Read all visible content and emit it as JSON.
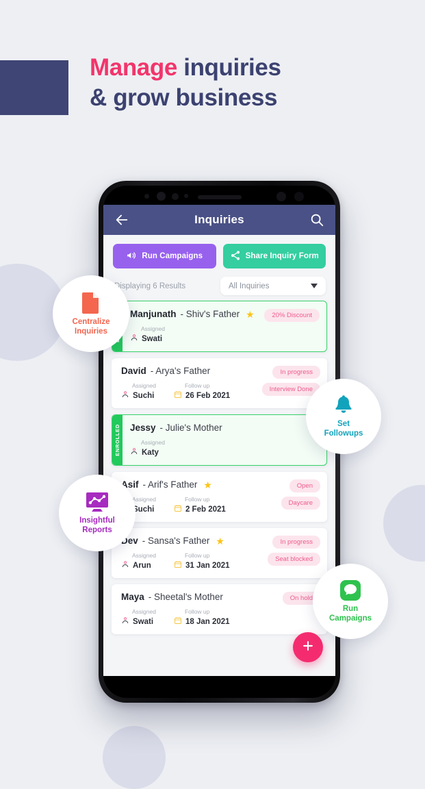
{
  "headline": {
    "line1_highlight": "Manage",
    "line1_rest": "inquiries",
    "line2": "& grow business",
    "highlight_color": "#F2356B",
    "text_color": "#3C4270"
  },
  "appbar": {
    "title": "Inquiries",
    "back_icon": "back-arrow-icon",
    "search_icon": "search-icon",
    "background": "#4A5186"
  },
  "actions": [
    {
      "label": "Run Campaigns",
      "icon": "megaphone-icon",
      "color": "#9761EE"
    },
    {
      "label": "Share Inquiry Form",
      "icon": "share-icon",
      "color": "#34CEA0"
    }
  ],
  "filter": {
    "results_text": "Displaying 6 Results",
    "dropdown_value": "All Inquiries",
    "caret_icon": "chevron-down-icon"
  },
  "labels": {
    "assigned": "Assigned",
    "followup": "Follow up",
    "enrolled": "ENROLLED",
    "person_icon": "person-icon",
    "calendar_icon": "calendar-icon"
  },
  "cards": [
    {
      "name": "Manjunath",
      "relation": "- Shiv's Father",
      "starred": true,
      "enrolled": true,
      "assigned": "Swati",
      "followup": "",
      "tags": [
        "20% Discount"
      ]
    },
    {
      "name": "David",
      "relation": "- Arya's Father",
      "starred": false,
      "enrolled": false,
      "assigned": "Suchi",
      "followup": "26 Feb 2021",
      "tags": [
        "In progress",
        "Interview Done"
      ]
    },
    {
      "name": "Jessy",
      "relation": "- Julie's Mother",
      "starred": false,
      "enrolled": true,
      "assigned": "Katy",
      "followup": "",
      "tags": []
    },
    {
      "name": "Asif",
      "relation": "- Arif's Father",
      "starred": true,
      "enrolled": false,
      "assigned": "Suchi",
      "followup": "2 Feb 2021",
      "tags": [
        "Open",
        "Daycare"
      ]
    },
    {
      "name": "Dev",
      "relation": "- Sansa's Father",
      "starred": true,
      "enrolled": false,
      "assigned": "Arun",
      "followup": "31 Jan 2021",
      "tags": [
        "In progress",
        "Seat blocked"
      ]
    },
    {
      "name": "Maya",
      "relation": "- Sheetal's Mother",
      "starred": false,
      "enrolled": false,
      "assigned": "Swati",
      "followup": "18 Jan 2021",
      "tags": [
        "On hold"
      ]
    }
  ],
  "fab": {
    "icon": "plus-icon",
    "color": "#F42C6F"
  },
  "badges": [
    {
      "line1": "Centralize",
      "line2": "Inquiries",
      "icon": "document-icon",
      "color": "#F2654F"
    },
    {
      "line1": "Set",
      "line2": "Followups",
      "icon": "bell-icon",
      "color": "#12A3BC"
    },
    {
      "line1": "Insightful",
      "line2": "Reports",
      "icon": "chart-monitor-icon",
      "color": "#A72BC0"
    },
    {
      "line1": "Run",
      "line2": "Campaigns",
      "icon": "chat-bubble-icon",
      "color": "#2FC24E"
    }
  ]
}
